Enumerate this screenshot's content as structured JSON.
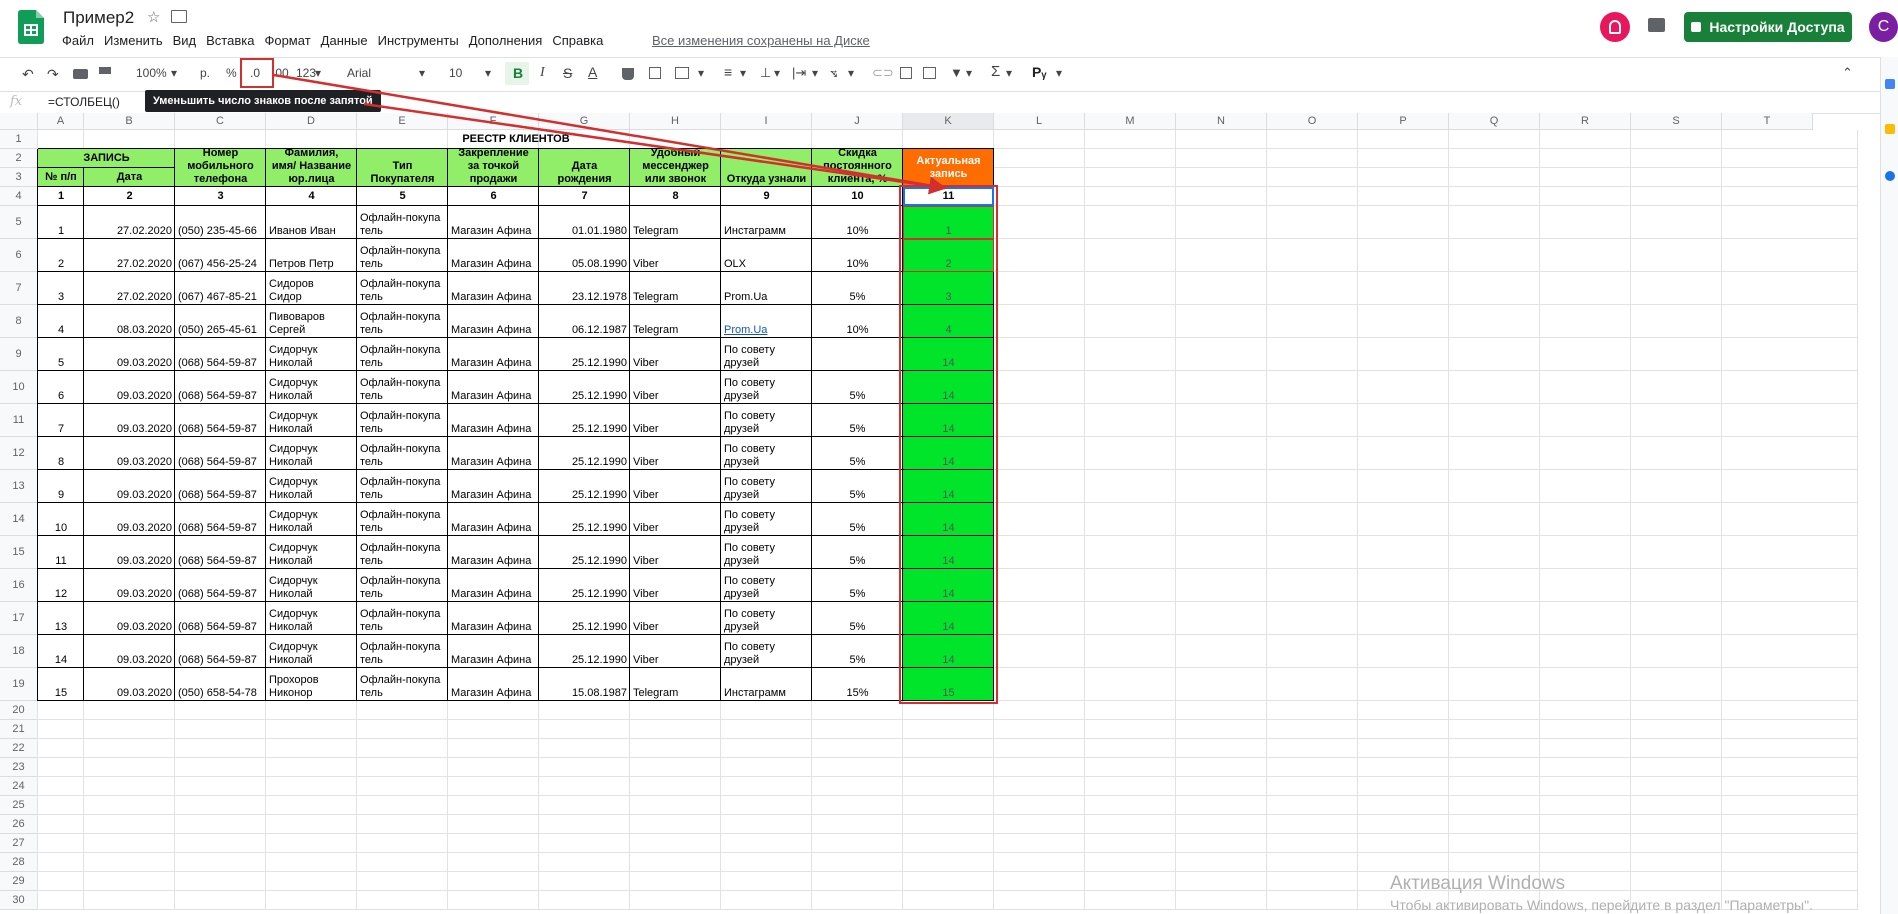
{
  "app": {
    "title": "Пример2",
    "menu": [
      "Файл",
      "Изменить",
      "Вид",
      "Вставка",
      "Формат",
      "Данные",
      "Инструменты",
      "Дополнения",
      "Справка"
    ],
    "saved_status": "Все изменения сохранены на Диске",
    "share_label": "Настройки Доступа",
    "user_initial": "C"
  },
  "toolbar": {
    "zoom": "100%",
    "currency": "р.",
    "percent": "%",
    "dec_decrease": ".0",
    "dec_increase": ".00",
    "format_more": "123",
    "font": "Arial",
    "font_size": "10",
    "bold": "B",
    "italic": "I",
    "strike": "S",
    "text_color": "A",
    "tooltip": "Уменьшить число знаков после запятой"
  },
  "formula_bar": {
    "fx": "fx",
    "value": "=СТОЛБЕЦ()"
  },
  "columns": [
    "A",
    "B",
    "C",
    "D",
    "E",
    "F",
    "G",
    "H",
    "I",
    "J",
    "K",
    "L",
    "M",
    "N",
    "O",
    "P",
    "Q",
    "R",
    "S",
    "T"
  ],
  "rows": [
    "1",
    "2",
    "3",
    "4",
    "5",
    "6",
    "7",
    "8",
    "9",
    "10",
    "11",
    "12",
    "13",
    "14",
    "15",
    "16",
    "17",
    "18",
    "19",
    "20",
    "21",
    "22",
    "23",
    "24",
    "25",
    "26",
    "27",
    "28",
    "29",
    "30"
  ],
  "sheet": {
    "title": "РЕЕСТР КЛИЕНТОВ",
    "headers": {
      "record": "ЗАПИСЬ",
      "num": "№ п/п",
      "date": "Дата",
      "phone_1": "Номер",
      "phone_2": "мобильного",
      "phone_3": "телефона",
      "name_1": "Фамилия,",
      "name_2": "имя/ Название",
      "name_3": "юр.лица",
      "type_1": "Тип",
      "type_2": "Покупателя",
      "store_1": "Закрепление",
      "store_2": "за точкой",
      "store_3": "продажи",
      "birth_1": "Дата",
      "birth_2": "рождения",
      "msg_1": "Удобный",
      "msg_2": "мессенджер",
      "msg_3": "или звонок",
      "source": "Откуда узнали",
      "disc_1": "Скидка",
      "disc_2": "постоянного",
      "disc_3": "клиента, %",
      "actual_1": "Актуальная",
      "actual_2": "запись"
    },
    "col_numbers": [
      "1",
      "2",
      "3",
      "4",
      "5",
      "6",
      "7",
      "8",
      "9",
      "10",
      "11"
    ],
    "data_rows": [
      {
        "n": "1",
        "date": "27.02.2020",
        "phone": "(050) 235-45-66",
        "name1": "Иванов Иван",
        "name2": "",
        "type1": "Офлайн-покупа",
        "type2": "тель",
        "store": "Магазин Афина",
        "birth": "01.01.1980",
        "msg": "Telegram",
        "src1": "Инстаграмм",
        "src2": "",
        "disc": "10%",
        "k": "1"
      },
      {
        "n": "2",
        "date": "27.02.2020",
        "phone": "(067) 456-25-24",
        "name1": "Петров Петр",
        "name2": "",
        "type1": "Офлайн-покупа",
        "type2": "тель",
        "store": "Магазин Афина",
        "birth": "05.08.1990",
        "msg": "Viber",
        "src1": "OLX",
        "src2": "",
        "disc": "10%",
        "k": "2"
      },
      {
        "n": "3",
        "date": "27.02.2020",
        "phone": "(067) 467-85-21",
        "name1": "Сидоров",
        "name2": "Сидор",
        "type1": "Офлайн-покупа",
        "type2": "тель",
        "store": "Магазин Афина",
        "birth": "23.12.1978",
        "msg": "Telegram",
        "src1": "Prom.Ua",
        "src2": "",
        "disc": "5%",
        "k": "3"
      },
      {
        "n": "4",
        "date": "08.03.2020",
        "phone": "(050) 265-45-61",
        "name1": "Пивоваров",
        "name2": "Сергей",
        "type1": "Офлайн-покупа",
        "type2": "тель",
        "store": "Магазин Афина",
        "birth": "06.12.1987",
        "msg": "Telegram",
        "src1": "Prom.Ua",
        "src2": "",
        "disc": "10%",
        "k": "4"
      },
      {
        "n": "5",
        "date": "09.03.2020",
        "phone": "(068) 564-59-87",
        "name1": "Сидорчук",
        "name2": "Николай",
        "type1": "Офлайн-покупа",
        "type2": "тель",
        "store": "Магазин Афина",
        "birth": "25.12.1990",
        "msg": "Viber",
        "src1": "По совету",
        "src2": "друзей",
        "disc": "",
        "k": "14"
      },
      {
        "n": "6",
        "date": "09.03.2020",
        "phone": "(068) 564-59-87",
        "name1": "Сидорчук",
        "name2": "Николай",
        "type1": "Офлайн-покупа",
        "type2": "тель",
        "store": "Магазин Афина",
        "birth": "25.12.1990",
        "msg": "Viber",
        "src1": "По совету",
        "src2": "друзей",
        "disc": "5%",
        "k": "14"
      },
      {
        "n": "7",
        "date": "09.03.2020",
        "phone": "(068) 564-59-87",
        "name1": "Сидорчук",
        "name2": "Николай",
        "type1": "Офлайн-покупа",
        "type2": "тель",
        "store": "Магазин Афина",
        "birth": "25.12.1990",
        "msg": "Viber",
        "src1": "По совету",
        "src2": "друзей",
        "disc": "5%",
        "k": "14"
      },
      {
        "n": "8",
        "date": "09.03.2020",
        "phone": "(068) 564-59-87",
        "name1": "Сидорчук",
        "name2": "Николай",
        "type1": "Офлайн-покупа",
        "type2": "тель",
        "store": "Магазин Афина",
        "birth": "25.12.1990",
        "msg": "Viber",
        "src1": "По совету",
        "src2": "друзей",
        "disc": "5%",
        "k": "14"
      },
      {
        "n": "9",
        "date": "09.03.2020",
        "phone": "(068) 564-59-87",
        "name1": "Сидорчук",
        "name2": "Николай",
        "type1": "Офлайн-покупа",
        "type2": "тель",
        "store": "Магазин Афина",
        "birth": "25.12.1990",
        "msg": "Viber",
        "src1": "По совету",
        "src2": "друзей",
        "disc": "5%",
        "k": "14"
      },
      {
        "n": "10",
        "date": "09.03.2020",
        "phone": "(068) 564-59-87",
        "name1": "Сидорчук",
        "name2": "Николай",
        "type1": "Офлайн-покупа",
        "type2": "тель",
        "store": "Магазин Афина",
        "birth": "25.12.1990",
        "msg": "Viber",
        "src1": "По совету",
        "src2": "друзей",
        "disc": "5%",
        "k": "14"
      },
      {
        "n": "11",
        "date": "09.03.2020",
        "phone": "(068) 564-59-87",
        "name1": "Сидорчук",
        "name2": "Николай",
        "type1": "Офлайн-покупа",
        "type2": "тель",
        "store": "Магазин Афина",
        "birth": "25.12.1990",
        "msg": "Viber",
        "src1": "По совету",
        "src2": "друзей",
        "disc": "5%",
        "k": "14"
      },
      {
        "n": "12",
        "date": "09.03.2020",
        "phone": "(068) 564-59-87",
        "name1": "Сидорчук",
        "name2": "Николай",
        "type1": "Офлайн-покупа",
        "type2": "тель",
        "store": "Магазин Афина",
        "birth": "25.12.1990",
        "msg": "Viber",
        "src1": "По совету",
        "src2": "друзей",
        "disc": "5%",
        "k": "14"
      },
      {
        "n": "13",
        "date": "09.03.2020",
        "phone": "(068) 564-59-87",
        "name1": "Сидорчук",
        "name2": "Николай",
        "type1": "Офлайн-покупа",
        "type2": "тель",
        "store": "Магазин Афина",
        "birth": "25.12.1990",
        "msg": "Viber",
        "src1": "По совету",
        "src2": "друзей",
        "disc": "5%",
        "k": "14"
      },
      {
        "n": "14",
        "date": "09.03.2020",
        "phone": "(068) 564-59-87",
        "name1": "Сидорчук",
        "name2": "Николай",
        "type1": "Офлайн-покупа",
        "type2": "тель",
        "store": "Магазин Афина",
        "birth": "25.12.1990",
        "msg": "Viber",
        "src1": "По совету",
        "src2": "друзей",
        "disc": "5%",
        "k": "14"
      },
      {
        "n": "15",
        "date": "09.03.2020",
        "phone": "(050) 658-54-78",
        "name1": "Прохоров",
        "name2": "Никонор",
        "type1": "Офлайн-покупа",
        "type2": "тель",
        "store": "Магазин Афина",
        "birth": "15.08.1987",
        "msg": "Telegram",
        "src1": "Инстаграмм",
        "src2": "",
        "disc": "15%",
        "k": "15"
      }
    ]
  },
  "watermark": {
    "line1": "Активация Windows",
    "line2": "Чтобы активировать Windows, перейдите в раздел \"Параметры\"."
  },
  "colors": {
    "header_green": "#90ee68",
    "k_green": "#00e52a",
    "orange": "#ff6d01",
    "highlight_red": "#d32f2f",
    "share_green": "#188038"
  }
}
